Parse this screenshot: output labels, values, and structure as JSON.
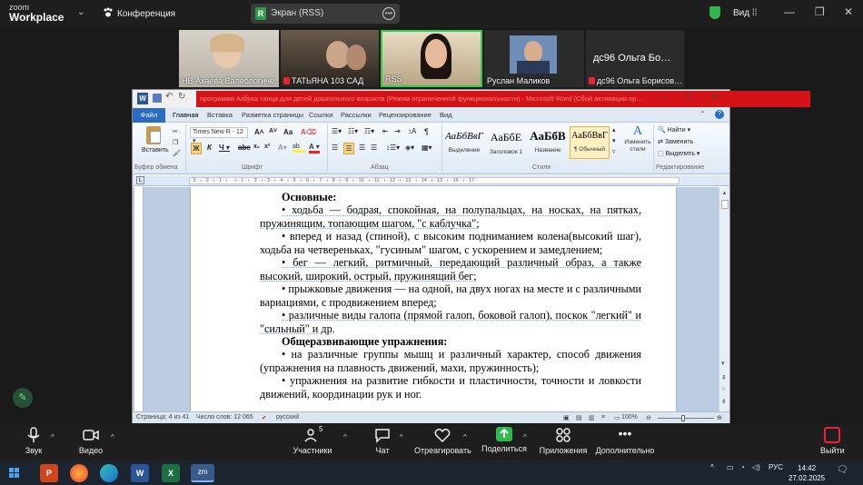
{
  "zoom": {
    "logo_line1": "zoom",
    "logo_line2": "Workplace",
    "conference_label": "Конференция",
    "share_badge": "R",
    "share_label": "Экран (RSS)",
    "view_label": "Вид",
    "participants": [
      {
        "name": "НВ Ахаева Валеологиче…",
        "muted": false
      },
      {
        "name": "ТАТЬЯНА 103 САД",
        "muted": true
      },
      {
        "name": "RSS",
        "muted": false
      },
      {
        "name": "Руслан Маликов",
        "muted": false
      },
      {
        "name": "дс96 Ольга Борисов…",
        "muted": true,
        "big_name": "дс96 Ольга Бо…"
      }
    ],
    "bottom": {
      "audio": "Звук",
      "video": "Видео",
      "participants": "Участники",
      "participants_count": "5",
      "chat": "Чат",
      "react": "Отреагировать",
      "share": "Поделиться",
      "apps": "Приложения",
      "more": "Дополнительно",
      "leave": "Выйти"
    }
  },
  "word": {
    "title": "программа Азбука танца для детей дошкольного возраста (Режим ограниченной функциональности) - Microsoft Word (Сбой активации пр…",
    "tabs": [
      "Файл",
      "Главная",
      "Вставка",
      "Разметка страницы",
      "Ссылки",
      "Рассылки",
      "Рецензирование",
      "Вид"
    ],
    "ribbon": {
      "paste": "Вставить",
      "font_name": "Times New R",
      "font_size": "12",
      "styles": [
        {
          "preview": "АаБбВвГ",
          "name": "Выделение"
        },
        {
          "preview": "АаБбЕ",
          "name": "Заголовок 1"
        },
        {
          "preview": "АаБбВ",
          "name": "Название"
        },
        {
          "preview": "АаБбВвГ",
          "name": "¶ Обычный"
        }
      ],
      "change_styles": "Изменить стили",
      "find": "Найти",
      "replace": "Заменить",
      "select": "Выделить",
      "groups": [
        "Буфер обмена",
        "Шрифт",
        "Абзац",
        "Стили",
        "Редактирование"
      ]
    },
    "ruler": "· 3 · ı · 2 · ı · 1 · ı ·   · ı · 1 · ı · 2 · ı · 3 · ı · 4 · ı · 5 · ı · 6 · ı · 7 · ı · 8 · ı · 9 · ı · 10 · ı · 11 · ı · 12 · ı · 13 · ı · 14 · ı · 15 · ı · 16 · ı · 17 ·",
    "doc": [
      {
        "text": "Основные:",
        "bold": true
      },
      {
        "text": "• ходьба — бодрая, спокойная, на полупальцах, на носках, на пятках, пружинящим, топающим шагом, \"с каблучка\";",
        "bold": false
      },
      {
        "text": "• вперед и назад (спиной), с высоким подниманием колена(высокий шаг), ходьба на четвереньках, \"гусиным\" шагом, с ускорением и замедлением;",
        "bold": false
      },
      {
        "text": "• бег — легкий, ритмичный, передающий различный образ, а также высокий, широкий, острый, пружинящий бег;",
        "bold": false
      },
      {
        "text": "• прыжковые движения — на одной, на двух ногах на месте и с различными вариациями, с продвижением вперед;",
        "bold": false
      },
      {
        "text": "• различные виды галопа (прямой галоп, боковой галоп), поскок \"легкий\" и \"сильный\" и др.",
        "bold": false
      },
      {
        "text": "Общеразвивающие упражнения:",
        "bold": true
      },
      {
        "text": "• на различные группы мышц и различный характер, способ движения (упражнения на плавность движений, махи, пружинность);",
        "bold": false
      },
      {
        "text": "• упражнения на развитие гибкости и пластичности, точности и ловкости движений, координации рук и ног.",
        "bold": false
      }
    ],
    "status": {
      "page": "Страница: 4 из 41",
      "words": "Число слов: 12 065",
      "lang": "русский",
      "zoom": "100%"
    }
  },
  "taskbar": {
    "lang": "РУС",
    "time": "14:42",
    "date": "27.02.2025"
  }
}
